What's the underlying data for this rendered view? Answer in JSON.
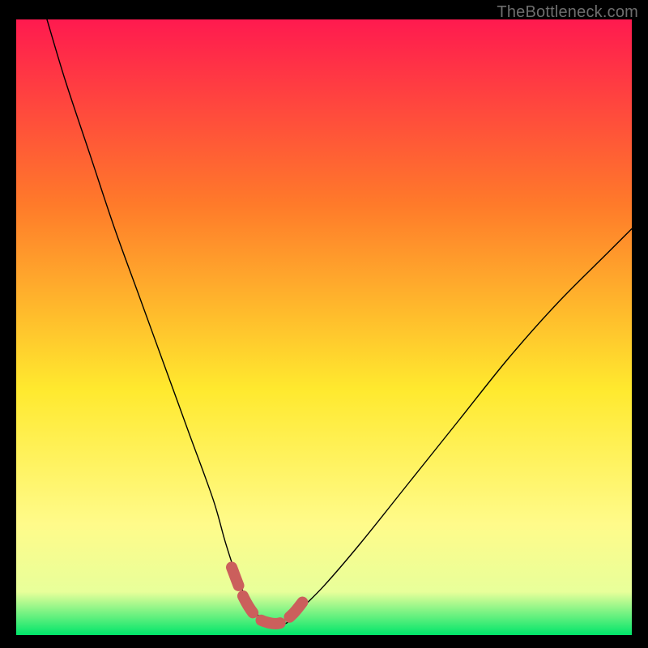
{
  "watermark": {
    "text": "TheBottleneck.com"
  },
  "colors": {
    "black": "#000000",
    "curve": "#000000",
    "highlight": "#cb5f5c",
    "grad_top": "#ff1a4f",
    "grad_mid_upper": "#ff7a2a",
    "grad_mid": "#ffe92e",
    "grad_mid_lower": "#fffb8a",
    "grad_lower": "#e8ff9a",
    "grad_bottom": "#00e56a"
  },
  "chart_data": {
    "type": "line",
    "title": "",
    "xlabel": "",
    "ylabel": "",
    "xlim": [
      0,
      100
    ],
    "ylim": [
      0,
      100
    ],
    "series": [
      {
        "name": "bottleneck-curve",
        "x": [
          5,
          8,
          12,
          16,
          20,
          24,
          28,
          32,
          34,
          36,
          38,
          40,
          42,
          44,
          46,
          50,
          56,
          64,
          72,
          80,
          88,
          96,
          100
        ],
        "y": [
          100,
          90,
          78,
          66,
          55,
          44,
          33,
          22,
          15,
          9,
          5,
          2.5,
          1.5,
          2,
          4,
          8,
          15,
          25,
          35,
          45,
          54,
          62,
          66
        ]
      },
      {
        "name": "optimal-range-highlight",
        "x": [
          35,
          37,
          39,
          41,
          43,
          45,
          47
        ],
        "y": [
          11,
          6,
          3,
          2,
          2,
          3.5,
          6
        ]
      }
    ],
    "background_gradient_stops": [
      {
        "pos": 0.0,
        "color": "#ff1a4f"
      },
      {
        "pos": 0.3,
        "color": "#ff7a2a"
      },
      {
        "pos": 0.6,
        "color": "#ffe92e"
      },
      {
        "pos": 0.82,
        "color": "#fffb8a"
      },
      {
        "pos": 0.93,
        "color": "#e8ff9a"
      },
      {
        "pos": 1.0,
        "color": "#00e56a"
      }
    ]
  }
}
